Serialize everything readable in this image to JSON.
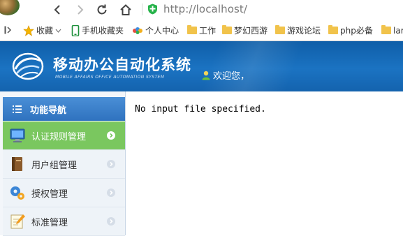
{
  "browser": {
    "url": "http://localhost/",
    "bookmarks": [
      {
        "label": "收藏",
        "icon": "star-icon"
      },
      {
        "label": "手机收藏夹",
        "icon": "phone-icon"
      },
      {
        "label": "个人中心",
        "icon": "colorful-logo-icon"
      },
      {
        "label": "工作",
        "icon": "folder-icon"
      },
      {
        "label": "梦幻西游",
        "icon": "folder-icon"
      },
      {
        "label": "游戏论坛",
        "icon": "folder-icon"
      },
      {
        "label": "php必备",
        "icon": "folder-icon"
      },
      {
        "label": "lar",
        "icon": "folder-icon"
      }
    ]
  },
  "app": {
    "title": "移动办公自动化系统",
    "subtitle": "MOBILE AFFAIRS OFFICE AUTOMATION SYSTEM",
    "welcome": "欢迎您，"
  },
  "sidebar": {
    "heading": "功能导航",
    "items": [
      {
        "label": "认证规则管理",
        "icon": "monitor-icon",
        "active": true
      },
      {
        "label": "用户组管理",
        "icon": "book-icon",
        "active": false
      },
      {
        "label": "授权管理",
        "icon": "gears-icon",
        "active": false
      },
      {
        "label": "标准管理",
        "icon": "notepad-icon",
        "active": false
      }
    ]
  },
  "content": {
    "message": "No input file specified."
  },
  "colors": {
    "header_blue": "#1b73c2",
    "active_green": "#7ac75f",
    "sidebar_head": "#3a7fcb"
  }
}
